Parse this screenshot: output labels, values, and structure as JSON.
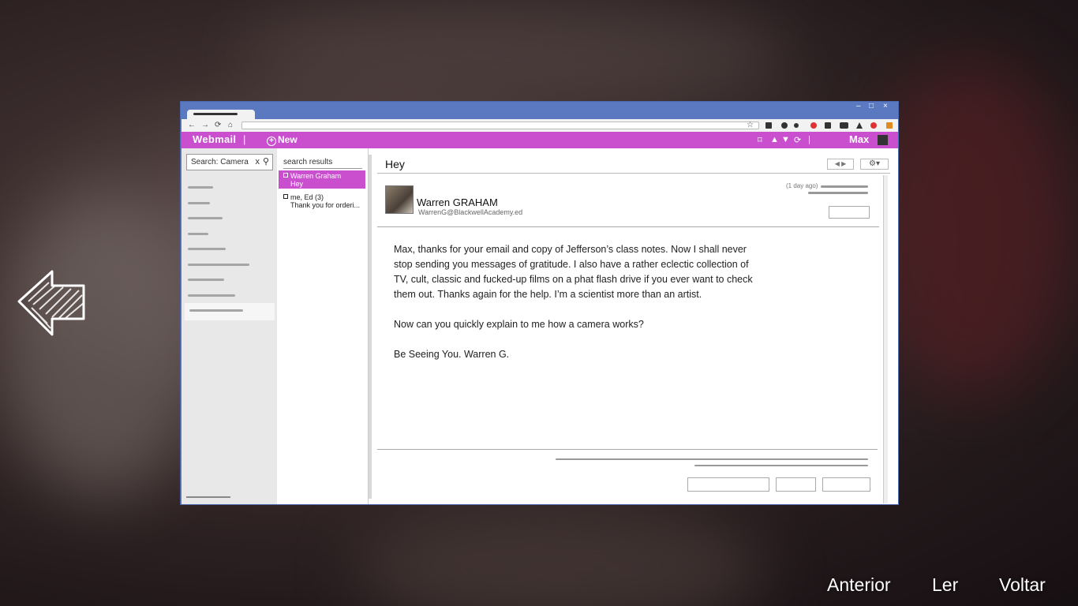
{
  "browser": {
    "nav": {
      "back": "←",
      "forward": "→",
      "reload": "⟳",
      "home": "⌂",
      "star": "☆"
    },
    "controls": {
      "minimize": "–",
      "maximize": "□",
      "close": "×"
    }
  },
  "webmail": {
    "brand": "Webmail",
    "separator": "|",
    "new_label": "New",
    "user": "Max"
  },
  "sidebar": {
    "search_value": "Search: Camera",
    "search_clear": "x",
    "search_icon": "search-icon"
  },
  "message_list": {
    "heading": "search results",
    "items": [
      {
        "from": "Warren Graham",
        "preview": "Hey",
        "selected": true
      },
      {
        "from": "me, Ed (3)",
        "preview": "Thank you for orderi...",
        "selected": false
      }
    ]
  },
  "message": {
    "subject": "Hey",
    "sender_name": "Warren GRAHAM",
    "sender_email": "WarrenG@BlackwellAcademy.ed",
    "date": "(1 day ago)",
    "body": [
      "Max, thanks for your email and copy of Jefferson’s class notes. Now I shall never stop sending you messages of gratitude. I also have a rather eclectic collection of TV, cult, classic and fucked-up films on a phat flash drive if you ever want to check them out. Thanks again for the help. I’m a scientist more than an artist.",
      "Now can you quickly explain to me how a camera works?",
      "Be Seeing You. Warren G."
    ]
  },
  "game_menu": {
    "previous": "Anterior",
    "read": "Ler",
    "back": "Voltar"
  },
  "colors": {
    "accent": "#c94fcf",
    "window_frame": "#5a79c0"
  }
}
